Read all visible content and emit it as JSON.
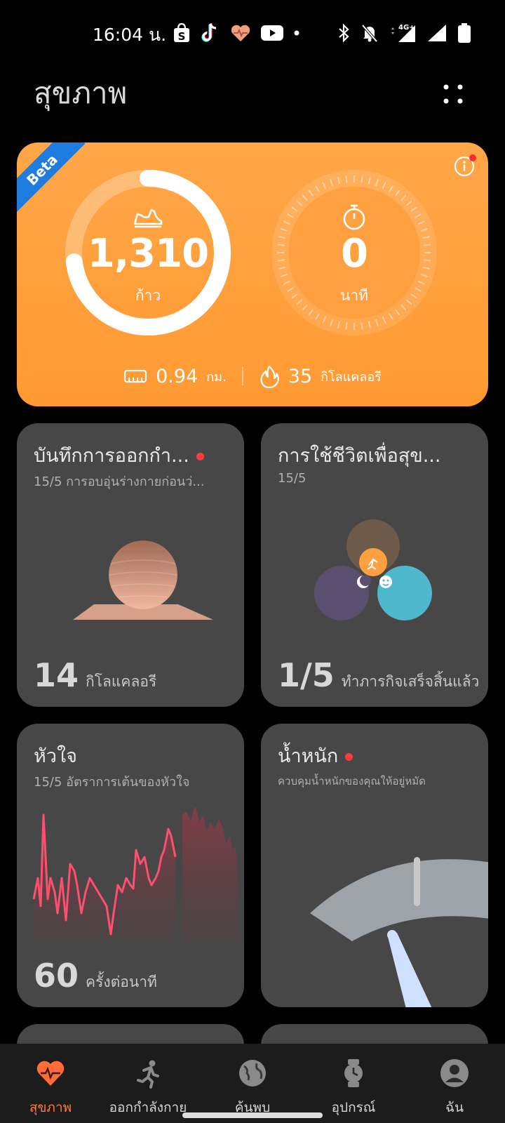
{
  "status_bar": {
    "time": "16:04 น.",
    "network": "4G+"
  },
  "header": {
    "title": "สุขภาพ"
  },
  "activity": {
    "badge": "Beta",
    "steps_value": "1,310",
    "steps_unit": "ก้าว",
    "steps_progress": 0.73,
    "time_value": "0",
    "time_unit": "นาที",
    "distance_value": "0.94",
    "distance_unit": "กม.",
    "calories_value": "35",
    "calories_unit": "กิโลแคลอรี"
  },
  "cards": {
    "exercise": {
      "title": "บันทึกการออกกำ...",
      "subtitle": "15/5 การอบอุ่นร่างกายก่อนว่...",
      "value": "14",
      "unit": "กิโลแคลอรี"
    },
    "healthy_living": {
      "title": "การใช้ชีวิตเพื่อสุข...",
      "subtitle": "15/5",
      "value": "1/5",
      "unit": "ทำภารกิจเสร็จสิ้นแล้ว"
    },
    "heart": {
      "title": "หัวใจ",
      "subtitle": "15/5 อัตราการเต้นของหัวใจ",
      "value": "60",
      "unit": "ครั้งต่อนาที"
    },
    "weight": {
      "title": "น้ำหนัก",
      "subtitle": "ควบคุมน้ำหนักของคุณให้อยู่หมัด"
    }
  },
  "nav": {
    "items": [
      {
        "label": "สุขภาพ",
        "icon": "heart-pulse-icon",
        "active": true
      },
      {
        "label": "ออกกำลังกาย",
        "icon": "running-icon",
        "active": false
      },
      {
        "label": "ค้นพบ",
        "icon": "globe-icon",
        "active": false
      },
      {
        "label": "อุปกรณ์",
        "icon": "watch-icon",
        "active": false
      },
      {
        "label": "ฉัน",
        "icon": "profile-icon",
        "active": false
      }
    ]
  },
  "colors": {
    "accent": "#ff7a3a",
    "activity_card": "#ffa144",
    "card_bg": "#474747",
    "heart_line": "#ff4f6e",
    "badge_blue": "#1f7de0"
  }
}
